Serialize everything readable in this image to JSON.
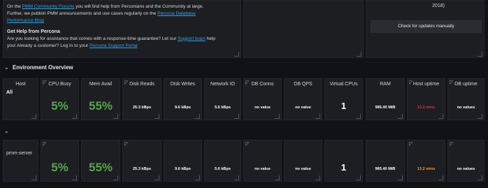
{
  "info": {
    "line1_a": "On the ",
    "line1_link": "PMM Community Forums",
    "line1_b": " you will find help from Perconians and the Community at large.",
    "line2_a": "Further, we publish PMM announcements and use cases regularly on the ",
    "line2_link": "Percona Database",
    "line3_link": "Performance Blog",
    "help_heading": "Get Help from Percona",
    "help1_a": "Are you looking for assistance that comes with a response-time guarantee? Let our ",
    "help1_link": "Support team",
    "help1_b": " help",
    "help2_a": "you! Already a customer? Log in to your ",
    "help2_link": "Percona Support Portal"
  },
  "update_panel": {
    "tail_text": "2018)",
    "check_button": "Check for updates manually"
  },
  "environment_overview": {
    "toggle_glyph": "⌄",
    "title": "Environment Overview"
  },
  "second_row": {
    "toggle_glyph": "⌄"
  },
  "columns": [
    "Host",
    "CPU Busy",
    "Mem Avail",
    "Disk Reads",
    "Disk Writes",
    "Network IO",
    "DB Conns",
    "DB QPS",
    "Virtual CPUs",
    "RAM",
    "Host uptime",
    "DB uptime"
  ],
  "rows": [
    {
      "host": "All",
      "values": [
        "5%",
        "55%",
        "25.3 kBps",
        "9.6 kBps",
        "5.6 kBps",
        "no value",
        "no value",
        "1",
        "985.40 MiB",
        "13.2 mins",
        "no values"
      ]
    },
    {
      "host": "pmm-server",
      "values": [
        "5%",
        "55%",
        "25.3 kBps",
        "9.6 kBps",
        "5.6 kBps",
        "no value",
        "no value",
        "1",
        "985.40 MiB",
        "13.2 mins",
        "no values"
      ]
    }
  ],
  "colors": {
    "background": "#111217",
    "panel": "#1d1e22",
    "green": "#56a64b",
    "orange": "#ff9830",
    "red": "#e02f44",
    "link": "#33a2e5"
  }
}
